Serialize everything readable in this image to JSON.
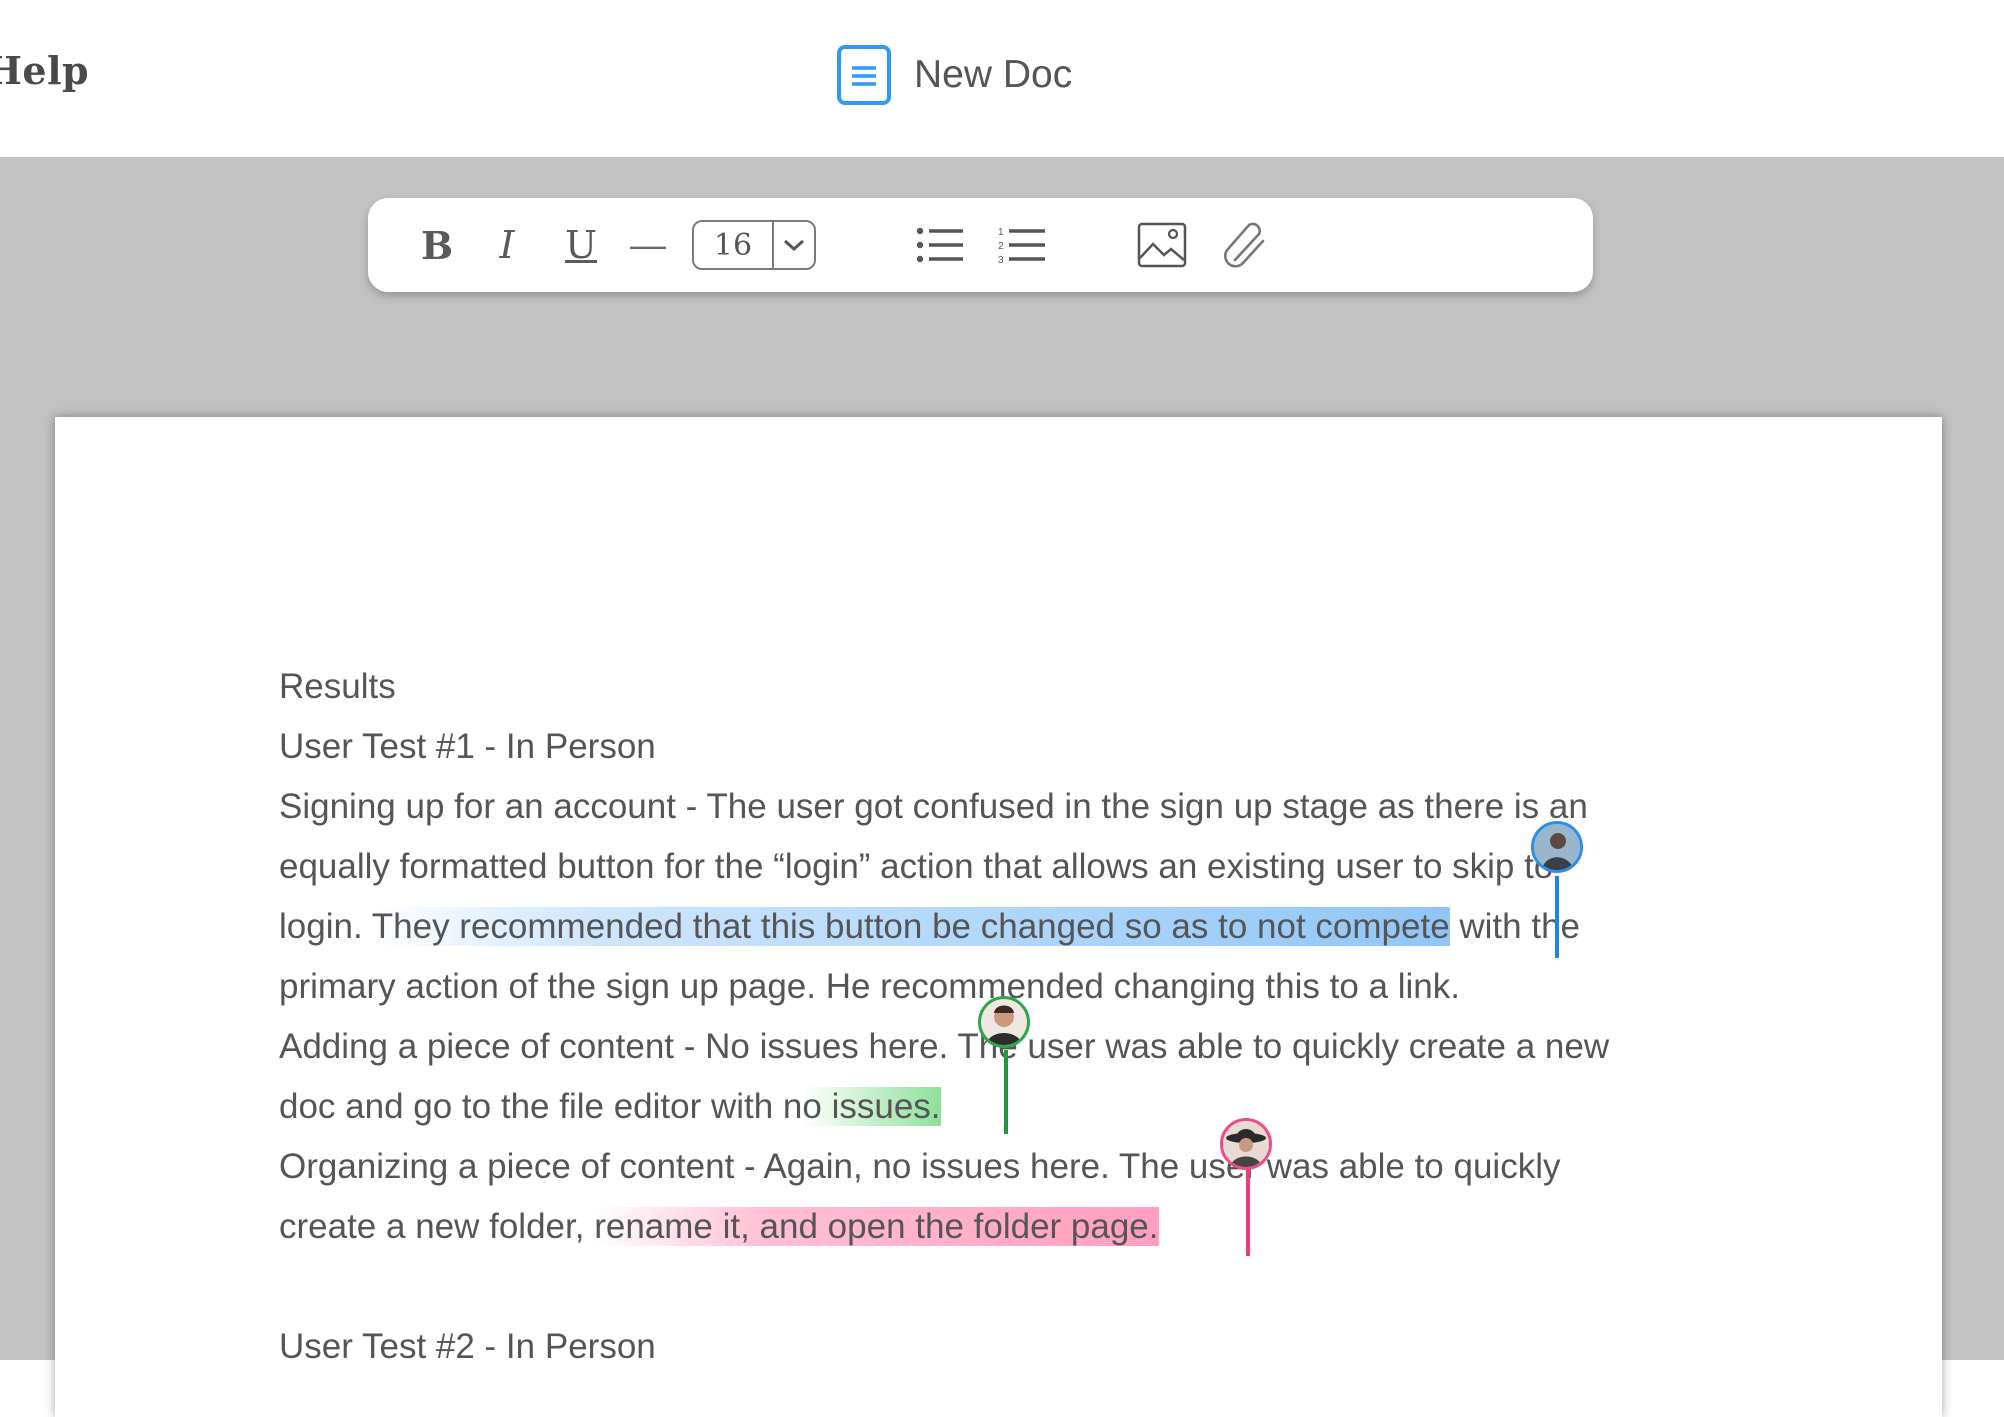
{
  "header": {
    "menu_help": "Help",
    "doc_title": "New Doc",
    "doc_icon": "document-icon"
  },
  "toolbar": {
    "bold": "B",
    "italic": "I",
    "underline": "U",
    "horizontal_rule": "—",
    "font_size": "16",
    "icons": [
      "bulleted-list-icon",
      "numbered-list-icon",
      "image-icon",
      "attachment-icon"
    ]
  },
  "document": {
    "lines": [
      "Results",
      "User Test #1 - In Person",
      "Signing up for an account - The user got confused in the sign up stage as there is an",
      "equally formatted button for the “login” action that allows an existing user to skip to",
      "login. They recommended that this button be changed so as to not compete with the",
      "primary action of the sign up page. He recommended changing this to a link.",
      "Adding a piece of content - No issues here. The user was able to quickly create a new",
      "doc and go to the file editor with no issues.",
      "Organizing a piece of content - Again, no issues here. The user was able to quickly",
      "create a new folder, rename it, and open the folder page.",
      "",
      "User Test #2 - In Person"
    ],
    "line4": {
      "before": "login. ",
      "highlight": "They recommended that this button be changed so as to not compete",
      "after": " with the"
    },
    "line7": {
      "before": "doc and go to the file editor with n",
      "highlight": "o issues.",
      "after": ""
    },
    "line9": {
      "before": "create a new folder, ",
      "highlight": "rename it, and open the folder page.",
      "after": ""
    }
  },
  "collaborators": [
    {
      "color": "#2b8fe6"
    },
    {
      "color": "#2aa84a"
    },
    {
      "color": "#ee4a86"
    }
  ]
}
